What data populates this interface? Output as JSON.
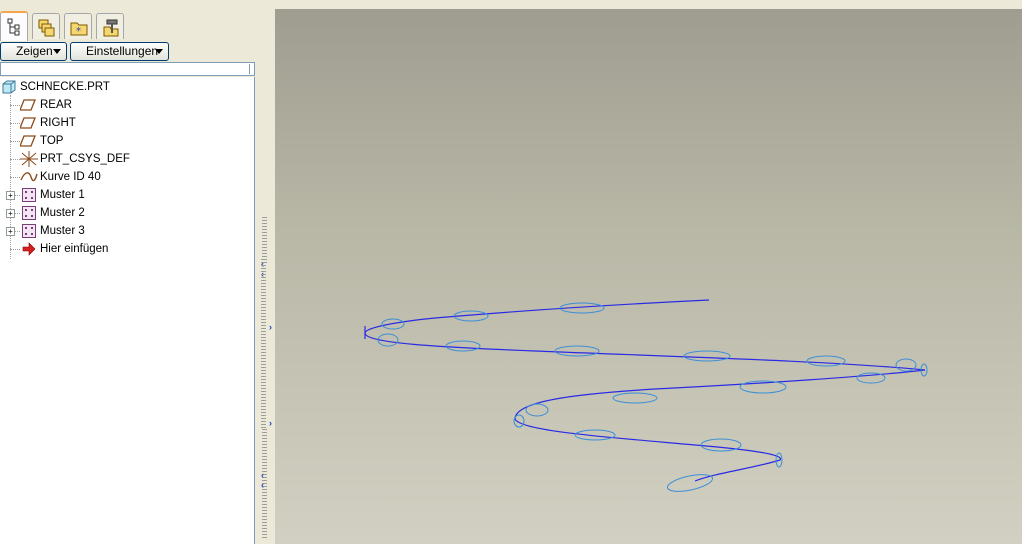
{
  "navigator": {
    "tabs": [
      {
        "icon": "model-tree-icon",
        "active": true
      },
      {
        "icon": "layers-icon",
        "active": false
      },
      {
        "icon": "folder-browser-icon",
        "active": false
      },
      {
        "icon": "favorites-tools-icon",
        "active": false
      }
    ],
    "show_label": "Zeigen",
    "settings_label": "Einstellungen",
    "tree": {
      "root": "SCHNECKE.PRT",
      "items": [
        {
          "label": "REAR",
          "icon": "datum-plane-icon"
        },
        {
          "label": "RIGHT",
          "icon": "datum-plane-icon"
        },
        {
          "label": "TOP",
          "icon": "datum-plane-icon"
        },
        {
          "label": "PRT_CSYS_DEF",
          "icon": "coordinate-system-icon"
        },
        {
          "label": "Kurve ID 40",
          "icon": "curve-icon"
        },
        {
          "label": "Muster 1",
          "icon": "pattern-icon",
          "expandable": true
        },
        {
          "label": "Muster 2",
          "icon": "pattern-icon",
          "expandable": true
        },
        {
          "label": "Muster 3",
          "icon": "pattern-icon",
          "expandable": true
        },
        {
          "label": "Hier einfügen",
          "icon": "insert-here-arrow-icon"
        }
      ]
    }
  },
  "colors": {
    "curve": "#2a2ae6",
    "ellipse": "#3a8fd8",
    "active_tab_accent": "#f5a64a"
  }
}
